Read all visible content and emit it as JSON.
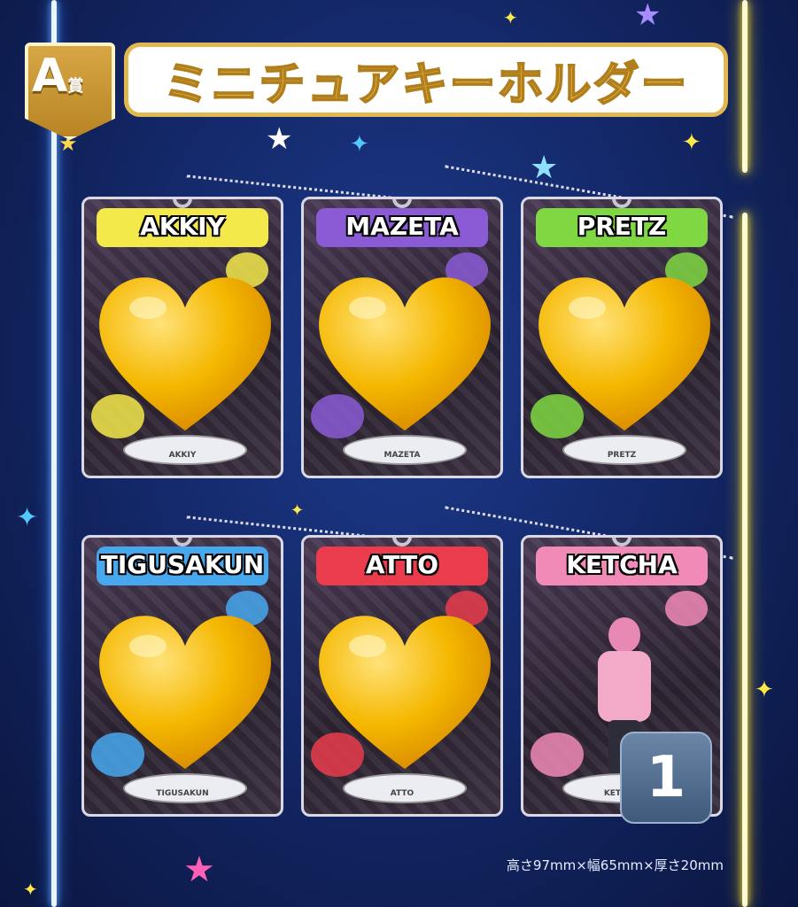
{
  "badge": {
    "letter": "A",
    "suffix": "賞"
  },
  "title": "ミニチュアキーホルダー",
  "cards": [
    {
      "name": "AKKIY",
      "base_label": "AKKIY",
      "accent": "#f4e94a",
      "pill": "#2b2b2b"
    },
    {
      "name": "MAZETA",
      "base_label": "MAZETA",
      "accent": "#8b5bd6",
      "pill": "#2b2b2b"
    },
    {
      "name": "PRETZ",
      "base_label": "PRETZ",
      "accent": "#7fd842",
      "pill": "#2b2b2b"
    },
    {
      "name": "TIGUSAKUN",
      "base_label": "TIGUSAKUN",
      "accent": "#48a8ee",
      "pill": "#2b2b2b"
    },
    {
      "name": "ATTO",
      "base_label": "ATTO",
      "accent": "#ea3c4c",
      "pill": "#2b2b2b"
    },
    {
      "name": "KETCHA",
      "base_label": "KETCHA",
      "accent": "#f18ab6",
      "pill": "#2b2b2b"
    }
  ],
  "overlay": {
    "icon": "gold-heart-icon",
    "color": "#f5b800"
  },
  "count_badge": "1",
  "dimensions": "高さ97mm×幅65mm×厚さ20mm"
}
